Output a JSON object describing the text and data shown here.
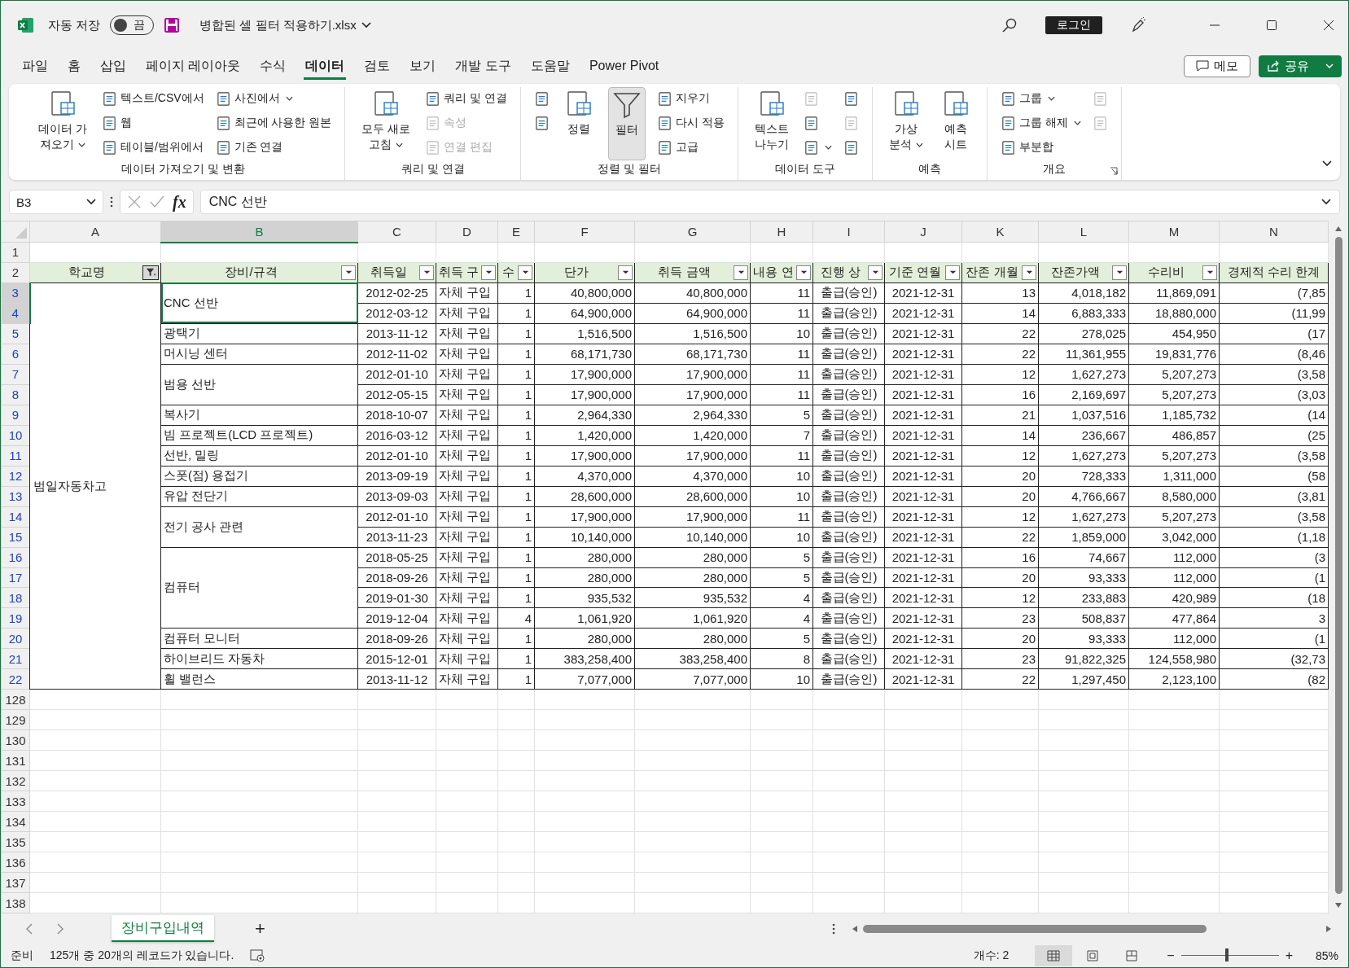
{
  "title_bar": {
    "autosave": {
      "label": "자동 저장",
      "state_text": "끔",
      "on": false
    },
    "filename": "병합된 셀 필터 적용하기.xlsx",
    "login": "로그인"
  },
  "tabs": [
    {
      "label": "파일",
      "selected": false
    },
    {
      "label": "홈",
      "selected": false
    },
    {
      "label": "삽입",
      "selected": false
    },
    {
      "label": "페이지 레이아웃",
      "selected": false
    },
    {
      "label": "수식",
      "selected": false
    },
    {
      "label": "데이터",
      "selected": true
    },
    {
      "label": "검토",
      "selected": false
    },
    {
      "label": "보기",
      "selected": false
    },
    {
      "label": "개발 도구",
      "selected": false
    },
    {
      "label": "도움말",
      "selected": false
    },
    {
      "label": "Power Pivot",
      "selected": false
    }
  ],
  "memo_button": "메모",
  "share_button": "공유",
  "ribbon": [
    {
      "label": "데이터 가져오기 및 변환",
      "launcher": false,
      "columns": [
        {
          "kind": "large",
          "lines": [
            "데이터 가",
            "져오기"
          ],
          "dropdown": true,
          "selected": false
        },
        {
          "kind": "stack",
          "items": [
            {
              "label": "텍스트/CSV에서",
              "dropdown": false,
              "disabled": false
            },
            {
              "label": "웹",
              "dropdown": false,
              "disabled": false
            },
            {
              "label": "테이블/범위에서",
              "dropdown": false,
              "disabled": false
            }
          ]
        },
        {
          "kind": "stack",
          "items": [
            {
              "label": "사진에서",
              "dropdown": true,
              "disabled": false
            },
            {
              "label": "최근에 사용한 원본",
              "dropdown": false,
              "disabled": false
            },
            {
              "label": "기존 연결",
              "dropdown": false,
              "disabled": false
            }
          ]
        }
      ]
    },
    {
      "label": "쿼리 및 연결",
      "launcher": false,
      "columns": [
        {
          "kind": "large",
          "lines": [
            "모두 새로",
            "고침"
          ],
          "dropdown": true,
          "selected": false
        },
        {
          "kind": "stack",
          "items": [
            {
              "label": "쿼리 및 연결",
              "dropdown": false,
              "disabled": false
            },
            {
              "label": "속성",
              "dropdown": false,
              "disabled": true
            },
            {
              "label": "연결 편집",
              "dropdown": false,
              "disabled": true
            }
          ]
        }
      ]
    },
    {
      "label": "정렬 및 필터",
      "launcher": false,
      "columns": [
        {
          "kind": "stack",
          "items": [
            {
              "dropdown": false,
              "disabled": false
            },
            {
              "dropdown": false,
              "disabled": false
            }
          ]
        },
        {
          "kind": "large",
          "lines": [
            "정렬"
          ],
          "dropdown": false,
          "selected": false
        },
        {
          "kind": "toggle",
          "lines": [
            "필터"
          ],
          "dropdown": false,
          "selected": true
        },
        {
          "kind": "stack",
          "items": [
            {
              "label": "지우기",
              "dropdown": false,
              "disabled": false
            },
            {
              "label": "다시 적용",
              "dropdown": false,
              "disabled": false
            },
            {
              "label": "고급",
              "dropdown": false,
              "disabled": false
            }
          ]
        }
      ]
    },
    {
      "label": "데이터 도구",
      "launcher": false,
      "columns": [
        {
          "kind": "large",
          "lines": [
            "텍스트",
            "나누기"
          ],
          "dropdown": false,
          "selected": false
        },
        {
          "kind": "stack",
          "items": [
            {
              "dropdown": false,
              "disabled": true
            },
            {
              "dropdown": false,
              "disabled": false
            },
            {
              "dropdown": true,
              "disabled": false
            }
          ]
        },
        {
          "kind": "stack",
          "items": [
            {
              "dropdown": false,
              "disabled": false
            },
            {
              "dropdown": false,
              "disabled": true
            },
            {
              "dropdown": false,
              "disabled": false
            }
          ]
        }
      ]
    },
    {
      "label": "예측",
      "launcher": false,
      "columns": [
        {
          "kind": "large",
          "lines": [
            "가상",
            "분석"
          ],
          "dropdown": true,
          "selected": false
        },
        {
          "kind": "large",
          "lines": [
            "예측",
            "시트"
          ],
          "dropdown": false,
          "selected": false
        }
      ]
    },
    {
      "label": "개요",
      "launcher": true,
      "columns": [
        {
          "kind": "stack",
          "items": [
            {
              "label": "그룹",
              "dropdown": true,
              "disabled": false
            },
            {
              "label": "그룹 해제",
              "dropdown": true,
              "disabled": false
            },
            {
              "label": "부분합",
              "dropdown": false,
              "disabled": false
            }
          ]
        },
        {
          "kind": "stack",
          "items": [
            {
              "dropdown": false,
              "disabled": true
            },
            {
              "dropdown": false,
              "disabled": true
            }
          ]
        }
      ]
    }
  ],
  "formula_bar": {
    "name_box": "B3",
    "function_label": "fx",
    "formula": "CNC 선반"
  },
  "sheet": {
    "columns": [
      {
        "letter": "A",
        "selected": false
      },
      {
        "letter": "B",
        "selected": true
      },
      {
        "letter": "C",
        "selected": false
      },
      {
        "letter": "D",
        "selected": false
      },
      {
        "letter": "E",
        "selected": false
      },
      {
        "letter": "F",
        "selected": false
      },
      {
        "letter": "G",
        "selected": false
      },
      {
        "letter": "H",
        "selected": false
      },
      {
        "letter": "I",
        "selected": false
      },
      {
        "letter": "J",
        "selected": false
      },
      {
        "letter": "K",
        "selected": false
      },
      {
        "letter": "L",
        "selected": false
      },
      {
        "letter": "M",
        "selected": false
      },
      {
        "letter": "N",
        "selected": false
      }
    ],
    "blank_row": "1",
    "header_row": "2",
    "headers": [
      {
        "label": "학교명",
        "filter_button": true,
        "filtered": true
      },
      {
        "label": "장비/규격",
        "filter_button": true,
        "filtered": false
      },
      {
        "label": "취득일",
        "filter_button": true,
        "filtered": false
      },
      {
        "label": "취득 구",
        "filter_button": true,
        "filtered": false
      },
      {
        "label": "수",
        "filter_button": true,
        "filtered": false
      },
      {
        "label": "단가",
        "filter_button": true,
        "filtered": false
      },
      {
        "label": "취득 금액",
        "filter_button": true,
        "filtered": false
      },
      {
        "label": "내용 연",
        "filter_button": true,
        "filtered": false
      },
      {
        "label": "진행 상",
        "filter_button": true,
        "filtered": false
      },
      {
        "label": "기준 연월",
        "filter_button": true,
        "filtered": false
      },
      {
        "label": "잔존 개월",
        "filter_button": true,
        "filtered": false
      },
      {
        "label": "잔존가액",
        "filter_button": true,
        "filtered": false
      },
      {
        "label": "수리비",
        "filter_button": true,
        "filtered": false
      },
      {
        "label": "경제적 수리 한계",
        "filter_button": false
      }
    ],
    "groups": [
      {
        "school": "범일자동차고",
        "equipment": [
          {
            "name": "CNC 선반",
            "selected": true,
            "records": [
              {
                "row": "3",
                "selected": true,
                "filtered": true,
                "cells": [
                  "2012-02-25",
                  "자체 구입",
                  "1",
                  "40,800,000",
                  "40,800,000",
                  "11",
                  "출급(승인)",
                  "2021-12-31",
                  "13",
                  "4,018,182",
                  "11,869,091",
                  "(7,85"
                ]
              },
              {
                "row": "4",
                "selected": true,
                "filtered": true,
                "cells": [
                  "2012-03-12",
                  "자체 구입",
                  "1",
                  "64,900,000",
                  "64,900,000",
                  "11",
                  "출급(승인)",
                  "2021-12-31",
                  "14",
                  "6,883,333",
                  "18,880,000",
                  "(11,99"
                ]
              }
            ]
          },
          {
            "name": "광택기",
            "selected": false,
            "records": [
              {
                "row": "5",
                "selected": false,
                "filtered": true,
                "cells": [
                  "2013-11-12",
                  "자체 구입",
                  "1",
                  "1,516,500",
                  "1,516,500",
                  "10",
                  "출급(승인)",
                  "2021-12-31",
                  "22",
                  "278,025",
                  "454,950",
                  "(17"
                ]
              }
            ]
          },
          {
            "name": "머시닝 센터",
            "selected": false,
            "records": [
              {
                "row": "6",
                "selected": false,
                "filtered": true,
                "cells": [
                  "2012-11-02",
                  "자체 구입",
                  "1",
                  "68,171,730",
                  "68,171,730",
                  "11",
                  "출급(승인)",
                  "2021-12-31",
                  "22",
                  "11,361,955",
                  "19,831,776",
                  "(8,46"
                ]
              }
            ]
          },
          {
            "name": "범용 선반",
            "selected": false,
            "records": [
              {
                "row": "7",
                "selected": false,
                "filtered": true,
                "cells": [
                  "2012-01-10",
                  "자체 구입",
                  "1",
                  "17,900,000",
                  "17,900,000",
                  "11",
                  "출급(승인)",
                  "2021-12-31",
                  "12",
                  "1,627,273",
                  "5,207,273",
                  "(3,58"
                ]
              },
              {
                "row": "8",
                "selected": false,
                "filtered": true,
                "cells": [
                  "2012-05-15",
                  "자체 구입",
                  "1",
                  "17,900,000",
                  "17,900,000",
                  "11",
                  "출급(승인)",
                  "2021-12-31",
                  "16",
                  "2,169,697",
                  "5,207,273",
                  "(3,03"
                ]
              }
            ]
          },
          {
            "name": "복사기",
            "selected": false,
            "records": [
              {
                "row": "9",
                "selected": false,
                "filtered": true,
                "cells": [
                  "2018-10-07",
                  "자체 구입",
                  "1",
                  "2,964,330",
                  "2,964,330",
                  "5",
                  "출급(승인)",
                  "2021-12-31",
                  "21",
                  "1,037,516",
                  "1,185,732",
                  "(14"
                ]
              }
            ]
          },
          {
            "name": "빔 프로젝트(LCD 프로젝트)",
            "selected": false,
            "records": [
              {
                "row": "10",
                "selected": false,
                "filtered": true,
                "cells": [
                  "2016-03-12",
                  "자체 구입",
                  "1",
                  "1,420,000",
                  "1,420,000",
                  "7",
                  "출급(승인)",
                  "2021-12-31",
                  "14",
                  "236,667",
                  "486,857",
                  "(25"
                ]
              }
            ]
          },
          {
            "name": "선반, 밀링",
            "selected": false,
            "records": [
              {
                "row": "11",
                "selected": false,
                "filtered": true,
                "cells": [
                  "2012-01-10",
                  "자체 구입",
                  "1",
                  "17,900,000",
                  "17,900,000",
                  "11",
                  "출급(승인)",
                  "2021-12-31",
                  "12",
                  "1,627,273",
                  "5,207,273",
                  "(3,58"
                ]
              }
            ]
          },
          {
            "name": "스폿(점) 용접기",
            "selected": false,
            "records": [
              {
                "row": "12",
                "selected": false,
                "filtered": true,
                "cells": [
                  "2013-09-19",
                  "자체 구입",
                  "1",
                  "4,370,000",
                  "4,370,000",
                  "10",
                  "출급(승인)",
                  "2021-12-31",
                  "20",
                  "728,333",
                  "1,311,000",
                  "(58"
                ]
              }
            ]
          },
          {
            "name": "유압 전단기",
            "selected": false,
            "records": [
              {
                "row": "13",
                "selected": false,
                "filtered": true,
                "cells": [
                  "2013-09-03",
                  "자체 구입",
                  "1",
                  "28,600,000",
                  "28,600,000",
                  "10",
                  "출급(승인)",
                  "2021-12-31",
                  "20",
                  "4,766,667",
                  "8,580,000",
                  "(3,81"
                ]
              }
            ]
          },
          {
            "name": "전기 공사 관련",
            "selected": false,
            "records": [
              {
                "row": "14",
                "selected": false,
                "filtered": true,
                "cells": [
                  "2012-01-10",
                  "자체 구입",
                  "1",
                  "17,900,000",
                  "17,900,000",
                  "11",
                  "출급(승인)",
                  "2021-12-31",
                  "12",
                  "1,627,273",
                  "5,207,273",
                  "(3,58"
                ]
              },
              {
                "row": "15",
                "selected": false,
                "filtered": true,
                "cells": [
                  "2013-11-23",
                  "자체 구입",
                  "1",
                  "10,140,000",
                  "10,140,000",
                  "10",
                  "출급(승인)",
                  "2021-12-31",
                  "22",
                  "1,859,000",
                  "3,042,000",
                  "(1,18"
                ]
              }
            ]
          },
          {
            "name": "컴퓨터",
            "selected": false,
            "records": [
              {
                "row": "16",
                "selected": false,
                "filtered": true,
                "cells": [
                  "2018-05-25",
                  "자체 구입",
                  "1",
                  "280,000",
                  "280,000",
                  "5",
                  "출급(승인)",
                  "2021-12-31",
                  "16",
                  "74,667",
                  "112,000",
                  "(3"
                ]
              },
              {
                "row": "17",
                "selected": false,
                "filtered": true,
                "cells": [
                  "2018-09-26",
                  "자체 구입",
                  "1",
                  "280,000",
                  "280,000",
                  "5",
                  "출급(승인)",
                  "2021-12-31",
                  "20",
                  "93,333",
                  "112,000",
                  "(1"
                ]
              },
              {
                "row": "18",
                "selected": false,
                "filtered": true,
                "cells": [
                  "2019-01-30",
                  "자체 구입",
                  "1",
                  "935,532",
                  "935,532",
                  "4",
                  "출급(승인)",
                  "2021-12-31",
                  "12",
                  "233,883",
                  "420,989",
                  "(18"
                ]
              },
              {
                "row": "19",
                "selected": false,
                "filtered": true,
                "cells": [
                  "2019-12-04",
                  "자체 구입",
                  "4",
                  "1,061,920",
                  "1,061,920",
                  "4",
                  "출급(승인)",
                  "2021-12-31",
                  "23",
                  "508,837",
                  "477,864",
                  "3"
                ]
              }
            ]
          },
          {
            "name": "컴퓨터 모니터",
            "selected": false,
            "records": [
              {
                "row": "20",
                "selected": false,
                "filtered": true,
                "cells": [
                  "2018-09-26",
                  "자체 구입",
                  "1",
                  "280,000",
                  "280,000",
                  "5",
                  "출급(승인)",
                  "2021-12-31",
                  "20",
                  "93,333",
                  "112,000",
                  "(1"
                ]
              }
            ]
          },
          {
            "name": "하이브리드 자동차",
            "selected": false,
            "records": [
              {
                "row": "21",
                "selected": false,
                "filtered": true,
                "cells": [
                  "2015-12-01",
                  "자체 구입",
                  "1",
                  "383,258,400",
                  "383,258,400",
                  "8",
                  "출급(승인)",
                  "2021-12-31",
                  "23",
                  "91,822,325",
                  "124,558,980",
                  "(32,73"
                ]
              }
            ]
          },
          {
            "name": "휠 밸런스",
            "selected": false,
            "records": [
              {
                "row": "22",
                "selected": false,
                "filtered": true,
                "cells": [
                  "2013-11-12",
                  "자체 구입",
                  "1",
                  "7,077,000",
                  "7,077,000",
                  "10",
                  "출급(승인)",
                  "2021-12-31",
                  "22",
                  "1,297,450",
                  "2,123,100",
                  "(82"
                ]
              }
            ]
          }
        ]
      }
    ],
    "empty_rows": [
      "128",
      "129",
      "130",
      "131",
      "132",
      "133",
      "134",
      "135",
      "136",
      "137",
      "138"
    ]
  },
  "sheet_tabs": [
    {
      "label": "장비구입내역",
      "selected": true
    }
  ],
  "add_sheet": "+",
  "status_bar": {
    "mode": "준비",
    "records": "125개 중 20개의 레코드가 있습니다.",
    "count": "개수: 2",
    "views": [
      {
        "selected": true
      },
      {
        "selected": false
      },
      {
        "selected": false
      }
    ],
    "zoom_out": "−",
    "zoom_slider": {
      "level": 0.45
    },
    "zoom_in": "+",
    "zoom": "85%"
  }
}
